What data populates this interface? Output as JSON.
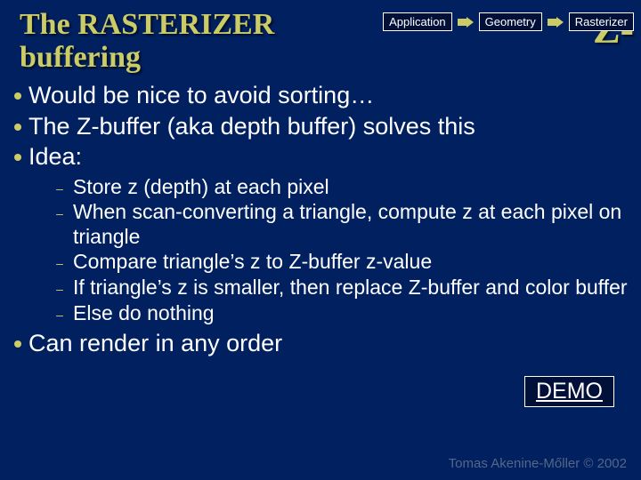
{
  "title": {
    "line1": "The RASTERIZER",
    "line2": "buffering",
    "z_label": "Z-"
  },
  "pipeline": {
    "stage1": "Application",
    "stage2": "Geometry",
    "stage3": "Rasterizer"
  },
  "bullets": [
    "Would be nice to avoid sorting…",
    "The Z-buffer (aka depth buffer) solves this",
    "Idea:"
  ],
  "sub_bullets": [
    "Store z (depth) at each pixel",
    "When scan-converting a triangle, compute z at each pixel on triangle",
    "Compare triangle’s z to Z-buffer z-value",
    "If triangle’s z is smaller, then replace Z-buffer and color buffer",
    "Else do nothing"
  ],
  "bullets_after": [
    "Can render in any order"
  ],
  "demo_label": "DEMO",
  "footer": "Tomas Akenine-Mőller © 2002"
}
